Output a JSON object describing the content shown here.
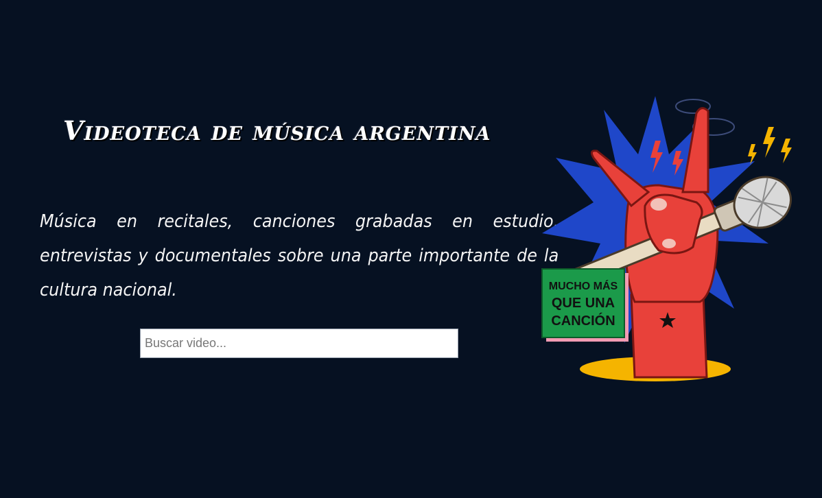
{
  "header": {
    "title": "Videoteca de música argentina"
  },
  "intro": {
    "text": "Música en recitales, canciones grabadas en estudio, entrevistas y documentales sobre una parte importante de la cultura nacional."
  },
  "search": {
    "placeholder": "Buscar video...",
    "value": ""
  },
  "illustration": {
    "badge_line1": "MUCHO MÁS",
    "badge_line2": "QUE UNA",
    "badge_line3": "CANCIÓN",
    "icons": [
      "rock-hand-icon",
      "microphone-icon",
      "star-icon",
      "lightning-icon"
    ]
  },
  "colors": {
    "background": "#061122",
    "hand": "#e8413a",
    "star_burst": "#1f47c9",
    "badge": "#1b9a4a",
    "base": "#f5b400",
    "mic_body": "#e9dcc3"
  }
}
